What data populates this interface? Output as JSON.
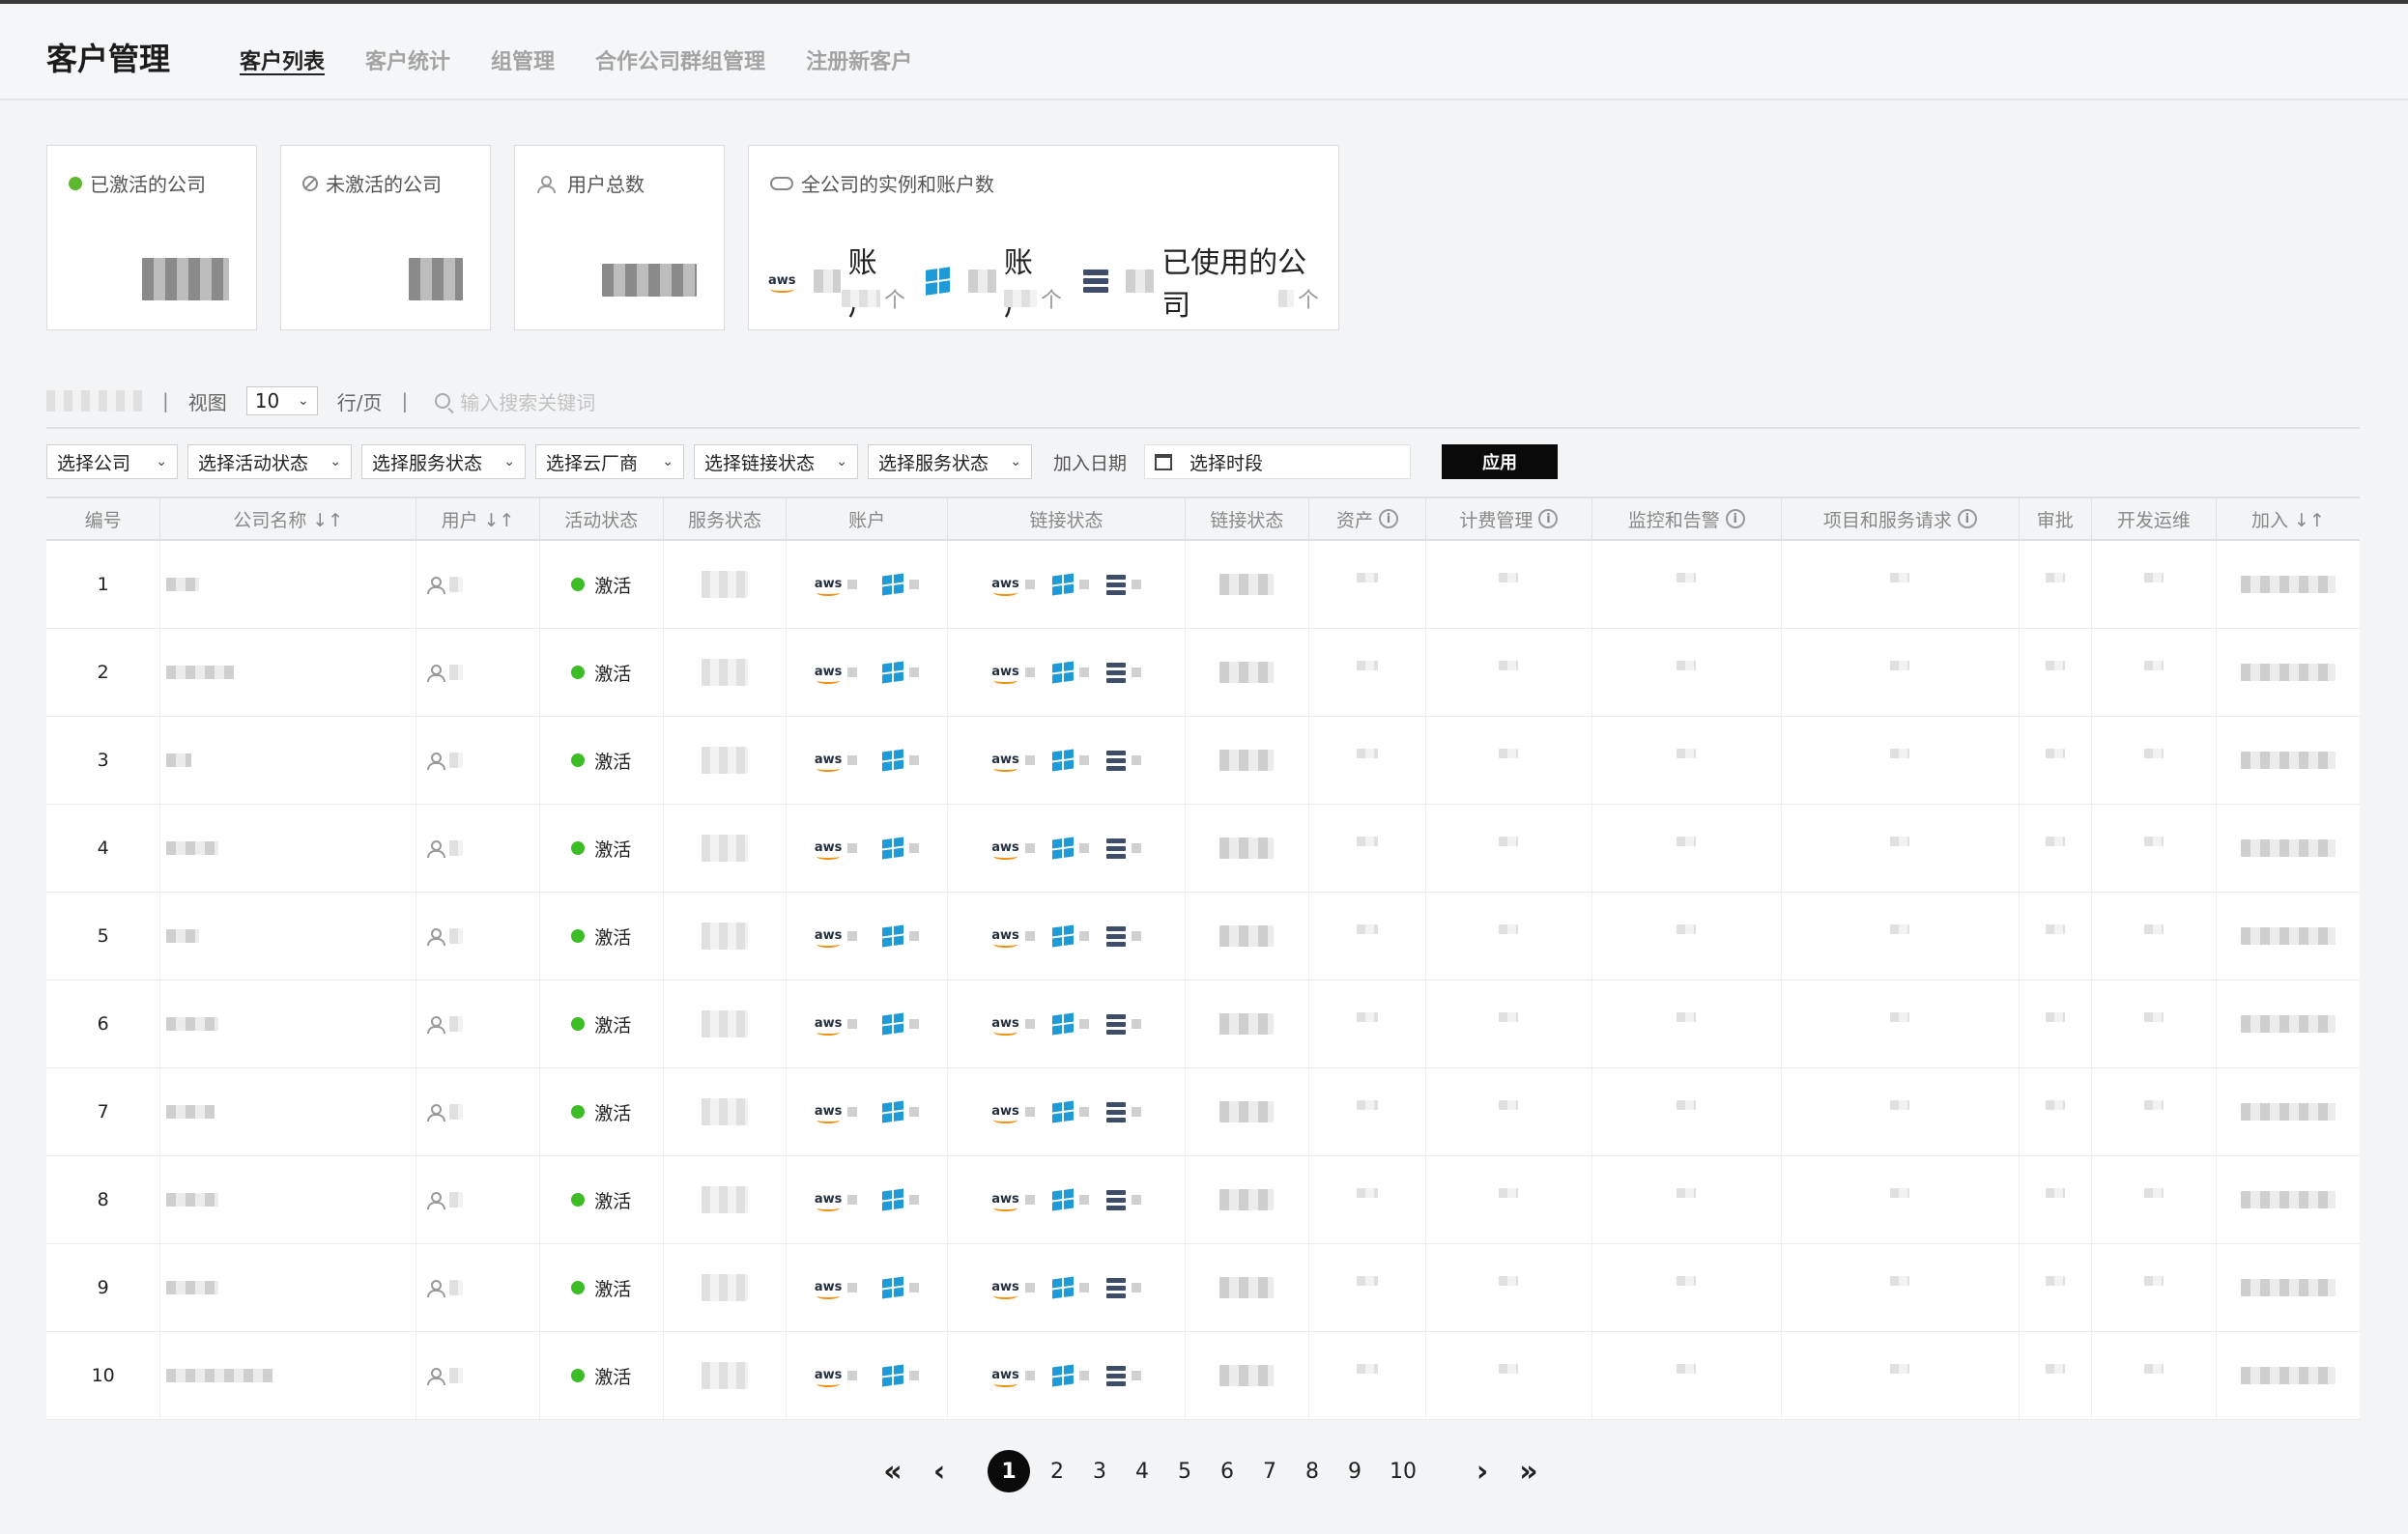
{
  "header": {
    "title": "客户管理",
    "tabs": [
      {
        "label": "客户列表",
        "active": true
      },
      {
        "label": "客户统计"
      },
      {
        "label": "组管理"
      },
      {
        "label": "合作公司群组管理"
      },
      {
        "label": "注册新客户"
      }
    ]
  },
  "cards": {
    "activated": {
      "label": "已激活的公司",
      "color": "#5cb82e"
    },
    "inactive": {
      "label": "未激活的公司"
    },
    "users": {
      "label": "用户总数"
    },
    "cloud": {
      "label": "全公司的实例和账户数",
      "aws_suffix": "账户",
      "azure_suffix": "账户",
      "server_suffix": "已使用的公司",
      "unit": "个"
    }
  },
  "toolbar": {
    "view_label": "视图",
    "rows_value": "10",
    "rows_unit": "行/页",
    "search_placeholder": "输入搜索关键词"
  },
  "filters": {
    "items": [
      "选择公司",
      "选择活动状态",
      "选择服务状态",
      "选择云厂商",
      "选择链接状态",
      "选择服务状态"
    ],
    "date_label": "加入日期",
    "date_placeholder": "选择时段",
    "apply_label": "应用"
  },
  "table": {
    "columns": [
      "编号",
      "公司名称 ↓↑",
      "用户 ↓↑",
      "活动状态",
      "服务状态",
      "账户",
      "链接状态",
      "链接状态",
      "资产",
      "计费管理",
      "监控和告警",
      "项目和服务请求",
      "审批",
      "开发运维",
      "加入 ↓↑"
    ],
    "status_color": "#3cbd26",
    "rows": [
      {
        "no": "1",
        "status": "激活"
      },
      {
        "no": "2",
        "status": "激活"
      },
      {
        "no": "3",
        "status": "激活"
      },
      {
        "no": "4",
        "status": "激活"
      },
      {
        "no": "5",
        "status": "激活"
      },
      {
        "no": "6",
        "status": "激活"
      },
      {
        "no": "7",
        "status": "激活"
      },
      {
        "no": "8",
        "status": "激活"
      },
      {
        "no": "9",
        "status": "激活"
      },
      {
        "no": "10",
        "status": "激活"
      }
    ]
  },
  "pagination": {
    "pages": [
      "1",
      "2",
      "3",
      "4",
      "5",
      "6",
      "7",
      "8",
      "9",
      "10"
    ],
    "current": "1",
    "first": "«",
    "prev": "‹",
    "next": "›",
    "last": "»"
  }
}
